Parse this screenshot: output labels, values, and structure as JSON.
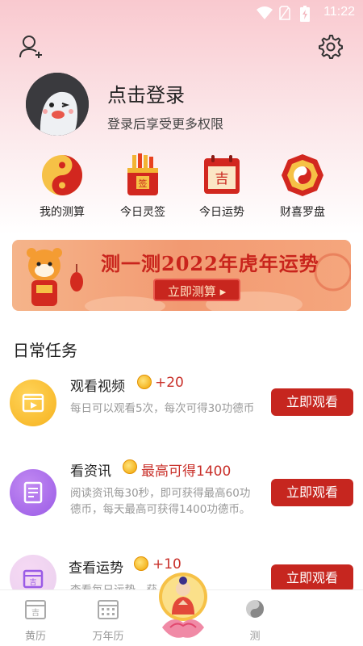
{
  "status_bar": {
    "time": "11:22"
  },
  "profile": {
    "login_title": "点击登录",
    "login_subtitle": "登录后享受更多权限"
  },
  "features": [
    {
      "label": "我的测算",
      "icon": "yin-yang-icon"
    },
    {
      "label": "今日灵签",
      "icon": "fortune-sticks-icon"
    },
    {
      "label": "今日运势",
      "icon": "calendar-ji-icon"
    },
    {
      "label": "财喜罗盘",
      "icon": "bagua-compass-icon"
    }
  ],
  "banner": {
    "title": "测一测2022年虎年运势",
    "button": "立即测算 ▸"
  },
  "daily_tasks": {
    "title": "日常任务",
    "items": [
      {
        "name": "观看视频",
        "reward": "+20",
        "desc": "每日可以观看5次，每次可得30功德币",
        "button": "立即观看"
      },
      {
        "name": "看资讯",
        "reward": "最高可得1400",
        "desc": "阅读资讯每30秒，即可获得最高60功德币，每天最高可获得1400功德币。",
        "button": "立即观看"
      },
      {
        "name": "查看运势",
        "reward": "+10",
        "desc": "查看每日运势，获",
        "button": "立即观看"
      }
    ]
  },
  "tabbar": {
    "items": [
      {
        "label": "黄历"
      },
      {
        "label": "万年历"
      },
      {
        "label": "测"
      }
    ]
  },
  "colors": {
    "accent": "#c6261f",
    "header_pink": "#f9c9cf"
  }
}
